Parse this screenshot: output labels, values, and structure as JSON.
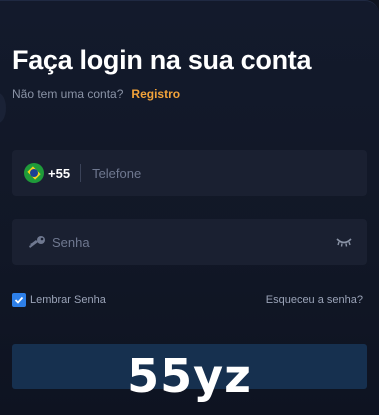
{
  "header": {
    "title": "Faça login na sua conta",
    "no_account_text": "Não tem uma conta?",
    "register_link": "Registro"
  },
  "phone_field": {
    "country_flag": "brazil-flag-icon",
    "country_code": "+55",
    "placeholder": "Telefone",
    "value": ""
  },
  "password_field": {
    "icon": "key-icon",
    "placeholder": "Senha",
    "value": "",
    "toggle_icon": "eye-closed-icon"
  },
  "remember": {
    "label": "Lembrar Senha",
    "checked": true
  },
  "forgot_link": "Esqueceu a senha?",
  "submit": {
    "label": ""
  },
  "watermark": "55yz",
  "colors": {
    "background": "#0f1420",
    "field_bg": "#1a2031",
    "accent_link": "#f2a33a",
    "checkbox": "#2d7fe8",
    "button": "#16304f"
  }
}
